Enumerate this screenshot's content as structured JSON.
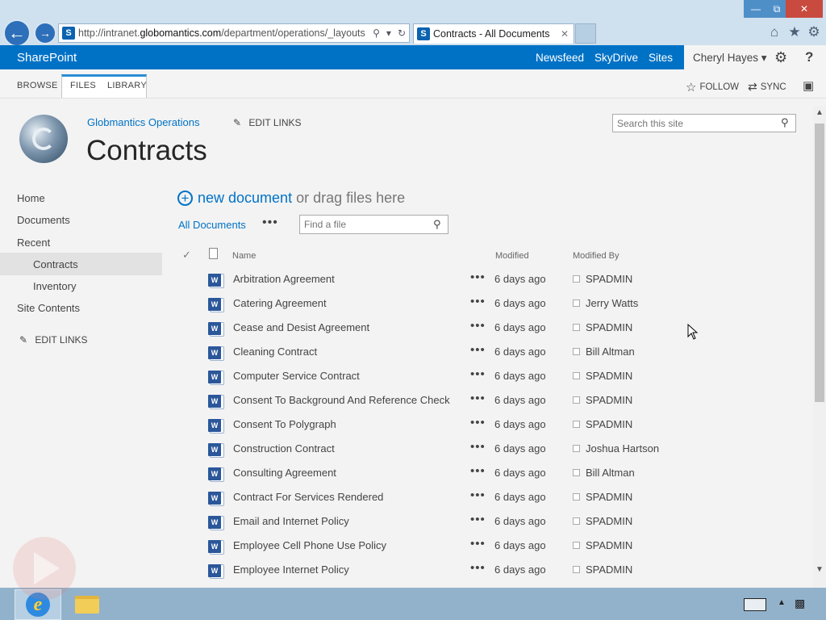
{
  "browser": {
    "url_prefix": "http://intranet.",
    "url_domain": "globomantics.com",
    "url_suffix": "/department/operations/_layouts",
    "tab_title": "Contracts - All Documents"
  },
  "suite": {
    "brand": "SharePoint",
    "links": [
      "Newsfeed",
      "SkyDrive",
      "Sites"
    ],
    "user": "Cheryl Hayes ▾"
  },
  "ribbon": {
    "tabs": [
      "BROWSE",
      "FILES",
      "LIBRARY"
    ],
    "follow": "FOLLOW",
    "sync": "SYNC"
  },
  "site": {
    "name": "Globmantics Operations",
    "edit_links": "EDIT LINKS",
    "title": "Contracts",
    "search_placeholder": "Search this site"
  },
  "nav": {
    "home": "Home",
    "documents": "Documents",
    "recent": "Recent",
    "contracts": "Contracts",
    "inventory": "Inventory",
    "site_contents": "Site Contents",
    "edit_links": "EDIT LINKS"
  },
  "library": {
    "new_document": "new document",
    "drag_text": "or drag files here",
    "view_name": "All Documents",
    "find_placeholder": "Find a file",
    "columns": {
      "name": "Name",
      "modified": "Modified",
      "modified_by": "Modified By"
    },
    "rows": [
      {
        "name": "Arbitration Agreement",
        "modified": "6 days ago",
        "by": "SPADMIN"
      },
      {
        "name": "Catering Agreement",
        "modified": "6 days ago",
        "by": "Jerry Watts"
      },
      {
        "name": "Cease and Desist Agreement",
        "modified": "6 days ago",
        "by": "SPADMIN"
      },
      {
        "name": "Cleaning Contract",
        "modified": "6 days ago",
        "by": "Bill Altman"
      },
      {
        "name": "Computer Service Contract",
        "modified": "6 days ago",
        "by": "SPADMIN"
      },
      {
        "name": "Consent To Background And Reference Check",
        "modified": "6 days ago",
        "by": "SPADMIN"
      },
      {
        "name": "Consent To Polygraph",
        "modified": "6 days ago",
        "by": "SPADMIN"
      },
      {
        "name": "Construction Contract",
        "modified": "6 days ago",
        "by": "Joshua Hartson"
      },
      {
        "name": "Consulting Agreement",
        "modified": "6 days ago",
        "by": "Bill Altman"
      },
      {
        "name": "Contract For Services Rendered",
        "modified": "6 days ago",
        "by": "SPADMIN"
      },
      {
        "name": "Email and Internet Policy",
        "modified": "6 days ago",
        "by": "SPADMIN"
      },
      {
        "name": "Employee Cell Phone Use Policy",
        "modified": "6 days ago",
        "by": "SPADMIN"
      },
      {
        "name": "Employee Internet Policy",
        "modified": "6 days ago",
        "by": "SPADMIN"
      }
    ]
  },
  "icons": {
    "word": "word-doc-icon",
    "settings": "gear-icon",
    "help": "help-icon",
    "search": "search-icon"
  },
  "colors": {
    "accent": "#0072c6",
    "word": "#2b579a"
  }
}
